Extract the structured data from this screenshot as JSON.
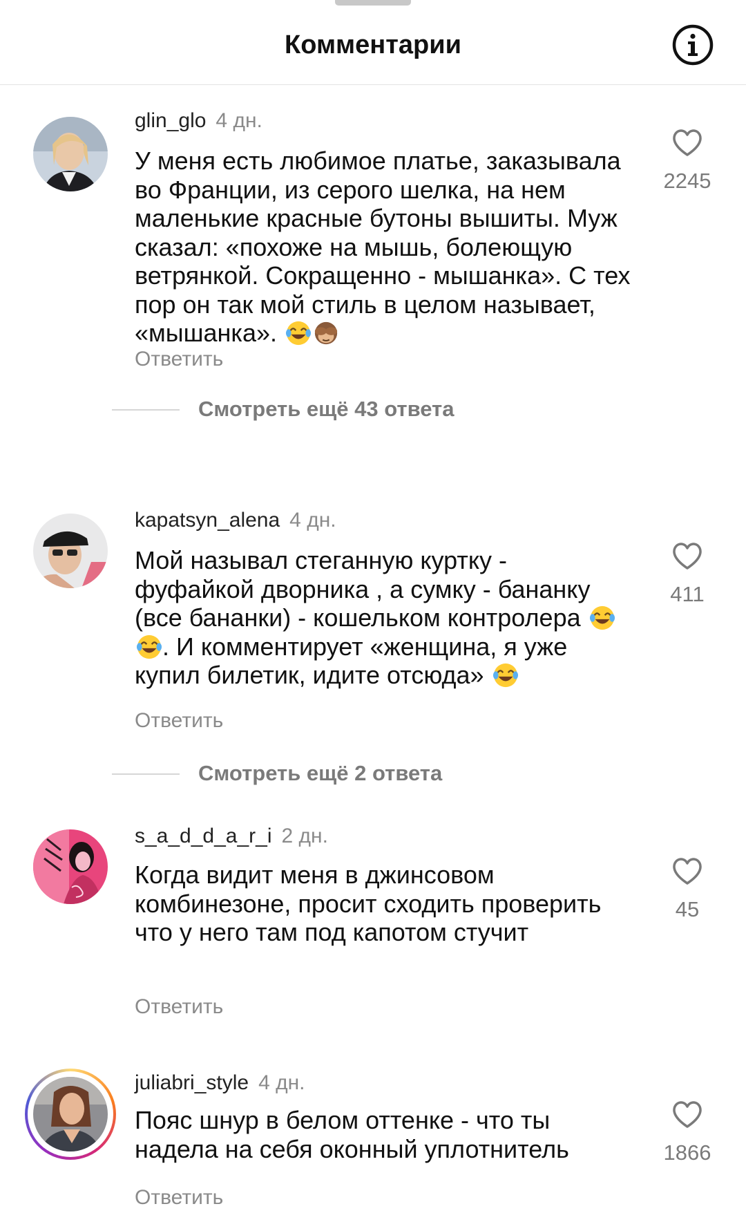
{
  "header": {
    "title": "Комментарии",
    "info_icon": "info-icon"
  },
  "comments": [
    {
      "username": "glin_glo",
      "time": "4 дн.",
      "text": "У меня есть любимое платье, заказывала во Франции, из серого шелка, на нем маленькие красные бутоны вышиты. Муж сказал: «похоже на мышь, болеющую ветрянкой. Сокращенно - мышанка». С тех пор он так мой стиль в целом называет, «мышанка».",
      "emojis": [
        "tears-of-joy-emoji",
        "see-no-evil-monkey-emoji"
      ],
      "reply_label": "Ответить",
      "likes": "2245",
      "more_replies": "Смотреть ещё 43 ответа"
    },
    {
      "username": "kapatsyn_alena",
      "time": "4 дн.",
      "text_part1": "Мой называл стеганную куртку - фуфайкой дворника , а сумку - бананку (все бананки) - кошельком контролера",
      "text_part2": ". И комментирует «женщина, я уже купил билетик, идите отсюда»",
      "emojis": [
        "tears-of-joy-emoji",
        "tears-of-joy-emoji",
        "tears-of-joy-emoji"
      ],
      "reply_label": "Ответить",
      "likes": "411",
      "more_replies": "Смотреть ещё 2 ответа"
    },
    {
      "username": "s_a_d_d_a_r_i",
      "time": "2 дн.",
      "text": "Когда видит меня в джинсовом комбинезоне, просит  сходить проверить что у него там под капотом стучит",
      "reply_label": "Ответить",
      "likes": "45"
    },
    {
      "username": "juliabri_style",
      "time": "4 дн.",
      "text": "Пояс шнур в белом оттенке - что ты надела на себя оконный уплотнитель",
      "reply_label": "Ответить",
      "likes": "1866"
    }
  ],
  "colors": {
    "text": "#111111",
    "muted": "#8a8a8a",
    "divider": "#e3e3e3"
  }
}
